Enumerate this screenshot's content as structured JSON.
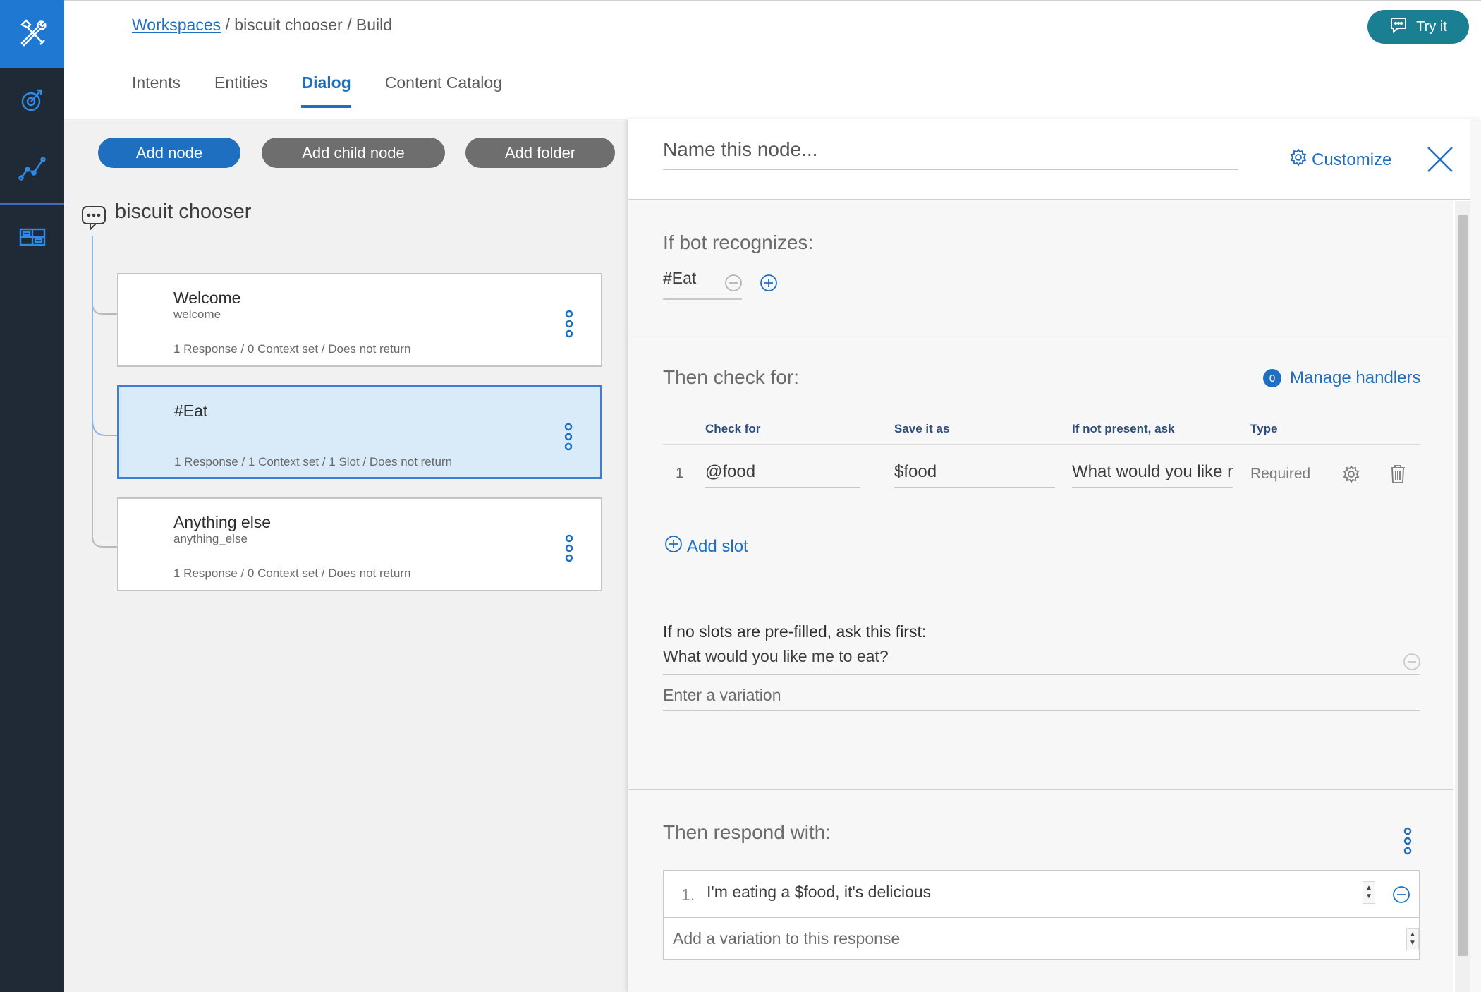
{
  "breadcrumb": {
    "link": "Workspaces",
    "rest": "/ biscuit chooser / Build"
  },
  "try_button": {
    "label": "Try it",
    "icon": "chat-icon"
  },
  "tabs": [
    {
      "label": "Intents"
    },
    {
      "label": "Entities"
    },
    {
      "label": "Dialog",
      "active": true
    },
    {
      "label": "Content Catalog"
    }
  ],
  "toolbar": {
    "add_node": "Add node",
    "add_child_node": "Add child node",
    "add_folder": "Add folder"
  },
  "tree": {
    "title": "biscuit chooser",
    "nodes": [
      {
        "title": "Welcome",
        "subtitle": "welcome",
        "meta": "1 Response / 0 Context set / Does not return"
      },
      {
        "title": "#Eat",
        "subtitle": "",
        "meta": "1 Response / 1 Context set / 1 Slot / Does not return",
        "selected": true
      },
      {
        "title": "Anything else",
        "subtitle": "anything_else",
        "meta": "1 Response / 0 Context set / Does not return"
      }
    ]
  },
  "editor": {
    "name_placeholder": "Name this node...",
    "customize_label": "Customize",
    "recognizes_title": "If bot recognizes:",
    "condition": "#Eat",
    "check_title": "Then check for:",
    "manage_count": "0",
    "manage_label": "Manage handlers",
    "columns": {
      "check_for": "Check for",
      "save_as": "Save it as",
      "ask": "If not present, ask",
      "type": "Type"
    },
    "slot": {
      "index": "1",
      "check_for": "@food",
      "save_as": "$food",
      "ask": "What would you like me to eat?",
      "type": "Required"
    },
    "add_slot": "Add slot",
    "prefill_label": "If no slots are pre-filled, ask this first:",
    "prefill_value": "What would you like me to eat?",
    "variation_placeholder": "Enter a variation",
    "respond_title": "Then respond with:",
    "response": {
      "index": "1.",
      "text": "I'm eating a $food, it's delicious"
    },
    "response_variation_placeholder": "Add a variation to this response"
  },
  "colors": {
    "rail": "#1f2a36",
    "accent": "#1f6fc1",
    "try_button": "#1a7f93"
  }
}
